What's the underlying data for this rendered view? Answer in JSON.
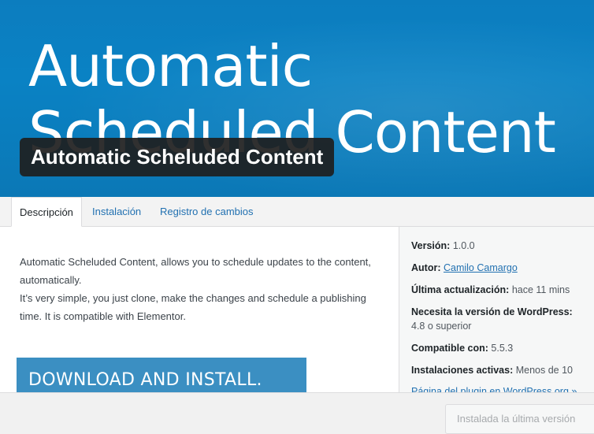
{
  "banner": {
    "background_text_line1": "Automatic",
    "background_text_line2": "Scheduled Content",
    "plugin_title": "Automatic Scheluded Content"
  },
  "tabs": [
    {
      "label": "Descripción",
      "active": true
    },
    {
      "label": "Instalación",
      "active": false
    },
    {
      "label": "Registro de cambios",
      "active": false
    }
  ],
  "description": {
    "paragraph1": "Automatic Scheluded Content, allows you to schedule updates to the content, automatically.",
    "paragraph2": "It’s very simple, you just clone, make the changes and schedule a publishing time. It is compatible with Elementor.",
    "download_label": "DOWNLOAD AND INSTALL."
  },
  "sidebar": {
    "version_label": "Versión:",
    "version_value": "1.0.0",
    "author_label": "Autor:",
    "author_value": "Camilo Camargo",
    "updated_label": "Última actualización:",
    "updated_value": "hace 11 mins",
    "requires_label": "Necesita la versión de WordPress:",
    "requires_value": "4.8 o superior",
    "compatible_label": "Compatible con:",
    "compatible_value": "5.5.3",
    "installs_label": "Instalaciones activas:",
    "installs_value": "Menos de 10",
    "plugin_page_link": "Página del plugin en WordPress.org »"
  },
  "footer": {
    "installed_button": "Instalada la última versión"
  },
  "colors": {
    "banner": "#0a82c4",
    "link": "#2271b1",
    "download_button": "#3b8fc2"
  }
}
